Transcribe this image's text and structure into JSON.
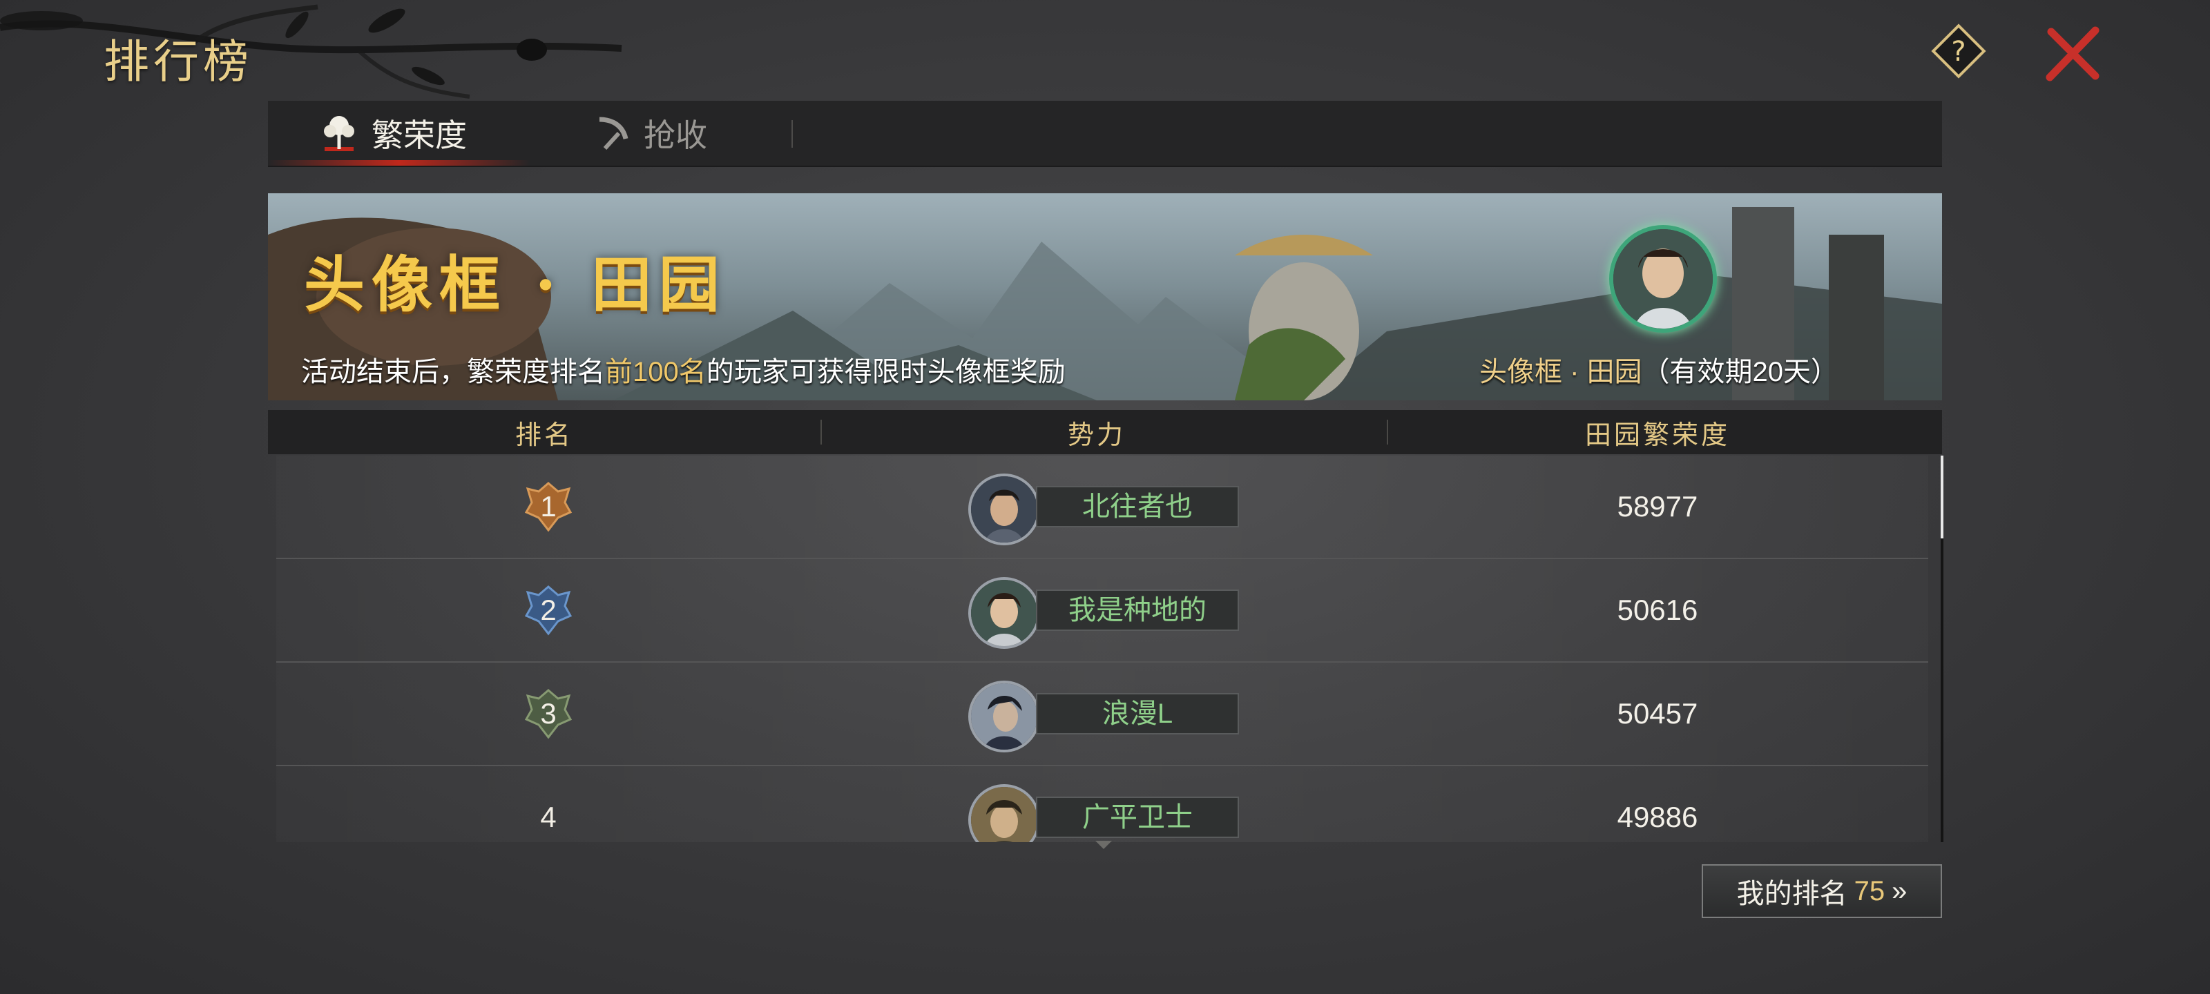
{
  "header": {
    "title": "排行榜"
  },
  "tabs": [
    {
      "label": "繁荣度",
      "icon": "prosperity-tree-icon",
      "active": true
    },
    {
      "label": "抢收",
      "icon": "sickle-icon",
      "active": false
    }
  ],
  "banner": {
    "title": "头像框 · 田园",
    "desc_prefix": "活动结束后，繁荣度排名",
    "desc_highlight": "前100名",
    "desc_suffix": "的玩家可获得限时头像框奖励",
    "reward_name": "头像框 · 田园",
    "reward_validity": "（有效期20天）"
  },
  "table": {
    "columns": [
      "排名",
      "势力",
      "田园繁荣度"
    ],
    "rows": [
      {
        "rank": "1",
        "name": "北往者也",
        "score": "58977",
        "badge": "gold"
      },
      {
        "rank": "2",
        "name": "我是种地的",
        "score": "50616",
        "badge": "blue"
      },
      {
        "rank": "3",
        "name": "浪漫L",
        "score": "50457",
        "badge": "green"
      },
      {
        "rank": "4",
        "name": "广平卫士",
        "score": "49886",
        "badge": "none"
      }
    ]
  },
  "my_rank": {
    "label": "我的排名",
    "value": "75",
    "arrow": "»"
  },
  "colors": {
    "accent_gold": "#e9cf8a",
    "player_name": "#8fd08a",
    "close_red": "#c8302a"
  }
}
